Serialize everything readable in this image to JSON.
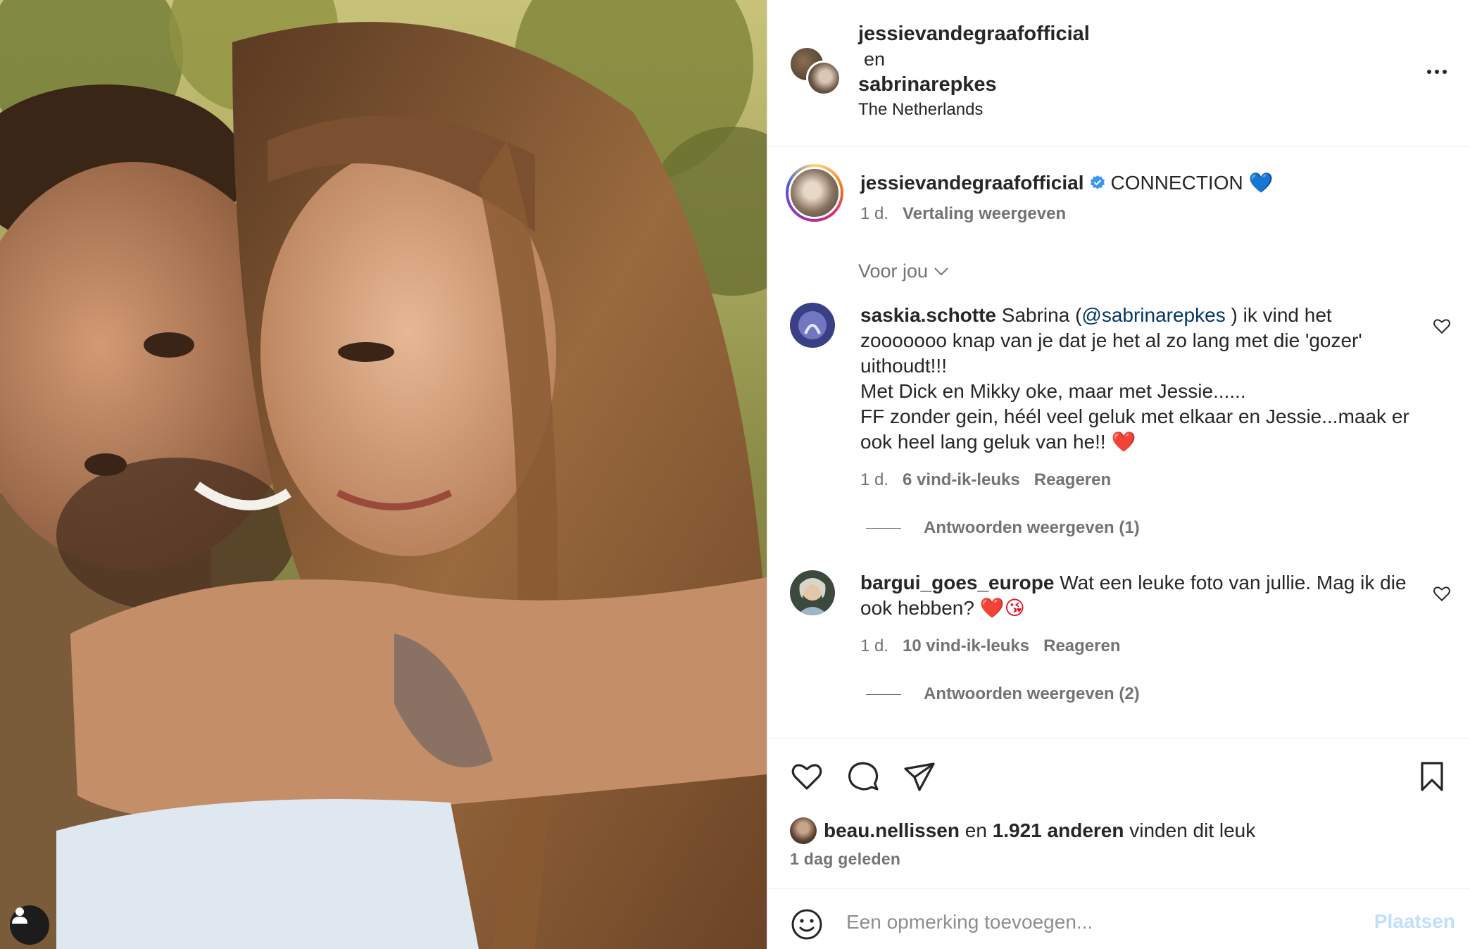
{
  "header": {
    "user1": "jessievandegraafofficial",
    "conjunction": "en",
    "user2": "sabrinarepkes",
    "location": "The Netherlands"
  },
  "caption": {
    "username": "jessievandegraafofficial",
    "text": "CONNECTION",
    "emoji": "💙",
    "time": "1 d.",
    "translate_label": "Vertaling weergeven"
  },
  "section_label": "Voor jou",
  "comments": [
    {
      "username": "saskia.schotte",
      "text_before": "Sabrina (",
      "mention": "@sabrinarepkes",
      "text_after": " ) ik vind het zooooooo knap van je dat je het al zo lang met die 'gozer' uithoudt!!!",
      "line2": "Met Dick en Mikky oke, maar met Jessie......",
      "line3": "FF zonder gein, héél veel geluk met elkaar en Jessie...maak er ook heel lang geluk van he!!",
      "emoji": "❤️",
      "time": "1 d.",
      "likes": "6 vind-ik-leuks",
      "reply_label": "Reageren",
      "view_replies": "Antwoorden weergeven (1)"
    },
    {
      "username": "bargui_goes_europe",
      "text": "Wat een leuke foto van jullie. Mag ik die ook hebben?",
      "emoji": "❤️😘",
      "time": "1 d.",
      "likes": "10 vind-ik-leuks",
      "reply_label": "Reageren",
      "view_replies": "Antwoorden weergeven (2)"
    }
  ],
  "likes": {
    "user": "beau.nellissen",
    "conjunction": "en",
    "count": "1.921 anderen",
    "suffix": "vinden dit leuk",
    "time": "1 dag geleden"
  },
  "comment_input": {
    "placeholder": "Een opmerking toevoegen...",
    "post_label": "Plaatsen"
  },
  "icons": {
    "more": "more-horizontal-icon",
    "like": "heart-icon",
    "comment": "comment-bubble-icon",
    "share": "paper-plane-icon",
    "save": "bookmark-icon",
    "emoji": "smiley-icon",
    "tag": "user-tag-icon",
    "verified": "verified-badge-icon"
  },
  "colors": {
    "text": "#262626",
    "secondary": "#737373",
    "mention": "#00376b",
    "verified": "#3897f0",
    "post_disabled": "#c0dffd"
  }
}
